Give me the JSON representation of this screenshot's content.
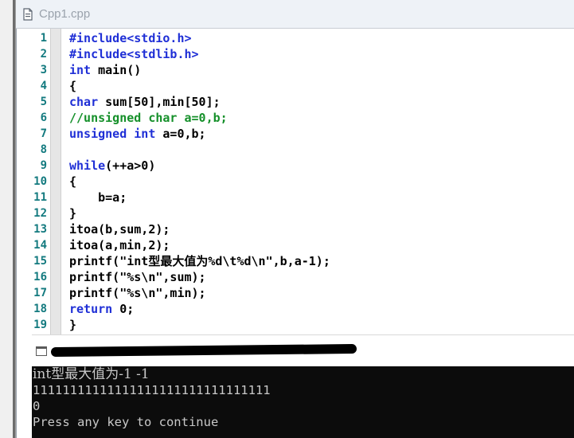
{
  "tab": {
    "title": "Cpp1.cpp",
    "icon": "document-icon"
  },
  "editor": {
    "line_numbers": [
      "1",
      "2",
      "3",
      "4",
      "5",
      "6",
      "7",
      "8",
      "9",
      "10",
      "11",
      "12",
      "13",
      "14",
      "15",
      "16",
      "17",
      "18",
      "19"
    ],
    "lines": [
      {
        "text": "#include<stdio.h>",
        "kind": "kw"
      },
      {
        "text": "#include<stdlib.h>",
        "kind": "kw"
      },
      {
        "parts": [
          [
            "int",
            "kw"
          ],
          [
            " main()",
            ""
          ]
        ]
      },
      {
        "text": "{",
        "kind": ""
      },
      {
        "parts": [
          [
            "char",
            "kw"
          ],
          [
            " sum[50],min[50];",
            ""
          ]
        ]
      },
      {
        "text": "//unsigned char a=0,b;",
        "kind": "cm"
      },
      {
        "parts": [
          [
            "unsigned",
            "kw"
          ],
          [
            " ",
            ""
          ],
          [
            "int",
            "kw"
          ],
          [
            " a=0,b;",
            ""
          ]
        ]
      },
      {
        "text": "",
        "kind": ""
      },
      {
        "parts": [
          [
            "while",
            "kw"
          ],
          [
            "(++a>0)",
            ""
          ]
        ]
      },
      {
        "text": "{",
        "kind": ""
      },
      {
        "text": "    b=a;",
        "kind": ""
      },
      {
        "text": "}",
        "kind": ""
      },
      {
        "text": "itoa(b,sum,2);",
        "kind": ""
      },
      {
        "text": "itoa(a,min,2);",
        "kind": ""
      },
      {
        "text": "printf(\"int型最大值为%d\\t%d\\n\",b,a-1);",
        "kind": ""
      },
      {
        "text": "printf(\"%s\\n\",sum);",
        "kind": ""
      },
      {
        "text": "printf(\"%s\\n\",min);",
        "kind": ""
      },
      {
        "parts": [
          [
            "return",
            "kw"
          ],
          [
            " 0;",
            ""
          ]
        ]
      },
      {
        "text": "}",
        "kind": ""
      }
    ]
  },
  "console": {
    "output": [
      "int型最大值为-1 -1",
      "11111111111111111111111111111111",
      "0",
      "Press any key to continue"
    ]
  },
  "colors": {
    "keyword": "#1f2fd6",
    "comment": "#15902a",
    "line_number": "#137a7f",
    "console_bg": "#0c0c0c",
    "console_fg": "#c8c8c8"
  }
}
